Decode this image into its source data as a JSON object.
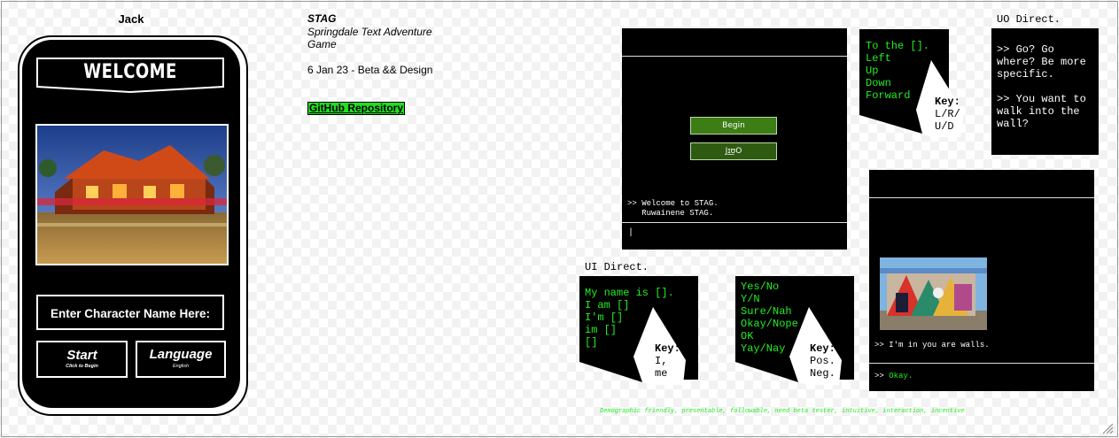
{
  "phone": {
    "user": "Jack",
    "welcome": "WELCOME",
    "name_placeholder": "Enter Character Name Here:",
    "start_label": "Start",
    "start_sub": "Click to Begin",
    "language_label": "Language",
    "language_sub": "English"
  },
  "info": {
    "title": "STAG",
    "subtitle": "Springdale Text Adventure Game",
    "date_note": "6 Jan 23 - Beta && Design",
    "github_link": "GitHub Repository"
  },
  "game": {
    "begin_label": "Begin",
    "second_label": "Jɪ͟ʊO",
    "log_line1": ">> Welcome to STAG.",
    "log_line2": "   Ruwainene STAG.",
    "cursor": "|"
  },
  "movement": {
    "lines": "To the [].\nLeft\nUp\nDown\nForward",
    "key_title": "Key:",
    "key_body": "L/R/\nU/D"
  },
  "uo": {
    "label": "UO Direct.",
    "line1": ">> Go? Go where? Be more specific.",
    "line2": ">> You want to walk into the wall?"
  },
  "ui_direct": {
    "label": "UI Direct.",
    "lines": "My name is [].\nI am []\nI'm []\nim []\n[]",
    "key_title": "Key:",
    "key_body": "I,\nme"
  },
  "yesno": {
    "lines": "Yes/No\nY/N\nSure/Nah\nOkay/Nope\nOK\nYay/Nay",
    "key_title": "Key:",
    "key_body": "Pos.\nNeg."
  },
  "room": {
    "text": ">> I'm in you are walls.",
    "reply_prompt": ">>",
    "reply_value": "Okay."
  },
  "footer": {
    "note": "Demographic friendly, presentable, followable, need beta tester, intuitive, interaction, incentive"
  },
  "colors": {
    "terminal_green": "#22ee22",
    "button_green": "#3d7d16",
    "link_green": "#22dd22"
  }
}
